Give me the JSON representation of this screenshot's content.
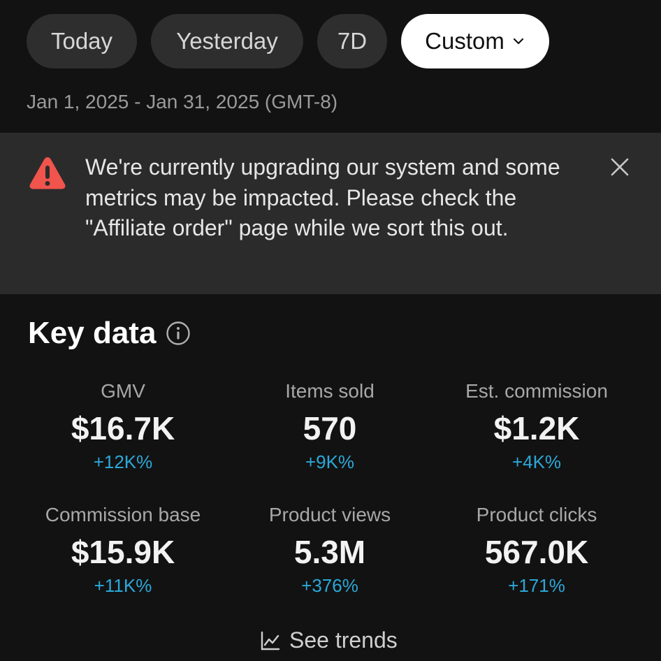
{
  "filters": {
    "today": "Today",
    "yesterday": "Yesterday",
    "seven_day": "7D",
    "custom": "Custom"
  },
  "date_range": "Jan 1, 2025 - Jan 31, 2025 (GMT-8)",
  "banner": {
    "message": "We're currently upgrading our system and some metrics may be impacted. Please check the \"Affiliate order\" page while we sort this out.",
    "icon": "warning-icon",
    "icon_color": "#f0544c"
  },
  "key_data": {
    "title": "Key data",
    "metrics": [
      {
        "label": "GMV",
        "value": "$16.7K",
        "change": "+12K%"
      },
      {
        "label": "Items sold",
        "value": "570",
        "change": "+9K%"
      },
      {
        "label": "Est. commission",
        "value": "$1.2K",
        "change": "+4K%"
      },
      {
        "label": "Commission base",
        "value": "$15.9K",
        "change": "+11K%"
      },
      {
        "label": "Product views",
        "value": "5.3M",
        "change": "+376%"
      },
      {
        "label": "Product clicks",
        "value": "567.0K",
        "change": "+171%"
      }
    ],
    "positive_color": "#2ba8d8"
  },
  "see_trends": "See trends"
}
